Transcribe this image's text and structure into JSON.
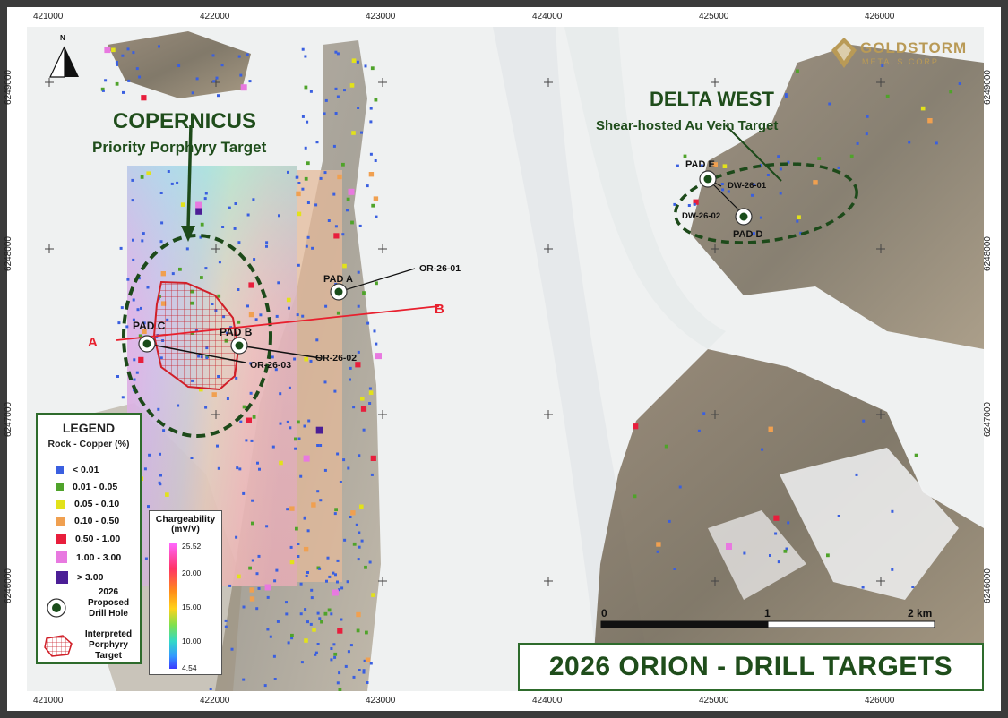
{
  "map_title": "2026 ORION - DRILL TARGETS",
  "logo": {
    "name": "GOLDSTORM",
    "sub": "METALS CORP"
  },
  "north_label": "N",
  "x_ticks": [
    "421000",
    "422000",
    "423000",
    "424000",
    "425000",
    "426000"
  ],
  "y_ticks": [
    "6249000",
    "6248000",
    "6247000",
    "6246000"
  ],
  "targets": {
    "copernicus": {
      "name": "COPERNICUS",
      "desc": "Priority Porphyry Target"
    },
    "delta_west": {
      "name": "DELTA WEST",
      "desc": "Shear-hosted Au Vein Target"
    }
  },
  "pads": {
    "a": "PAD A",
    "b": "PAD B",
    "c": "PAD C",
    "d": "PAD D",
    "e": "PAD E"
  },
  "holes": {
    "or01": "OR-26-01",
    "or02": "OR-26-02",
    "or03": "OR-26-03",
    "dw01": "DW-26-01",
    "dw02": "DW-26-02"
  },
  "section": {
    "a": "A",
    "b": "B"
  },
  "legend": {
    "title": "LEGEND",
    "subtitle": "Rock - Copper (%)",
    "items": [
      {
        "label": "< 0.01",
        "color": "#3a5fe0"
      },
      {
        "label": "0.01 - 0.05",
        "color": "#4fa32a"
      },
      {
        "label": "0.05 - 0.10",
        "color": "#e2e21a"
      },
      {
        "label": "0.10 - 0.50",
        "color": "#f0a050"
      },
      {
        "label": "0.50 - 1.00",
        "color": "#e81e3c"
      },
      {
        "label": "1.00 - 3.00",
        "color": "#e879e0"
      },
      {
        "label": "> 3.00",
        "color": "#4b1e96"
      }
    ],
    "drill_label_1": "2026",
    "drill_label_2": "Proposed",
    "drill_label_3": "Drill Hole",
    "target_label_1": "Interpreted",
    "target_label_2": "Porphyry",
    "target_label_3": "Target"
  },
  "chargeability": {
    "title": "Chargeability",
    "unit": "(mV/V)",
    "values": [
      "25.52",
      "20.00",
      "15.00",
      "10.00",
      "4.54"
    ]
  },
  "scale": {
    "l0": "0",
    "l1": "1",
    "l2": "2 km"
  },
  "colors": {
    "green_dark": "#1f4d1b",
    "red": "#e8202e"
  }
}
